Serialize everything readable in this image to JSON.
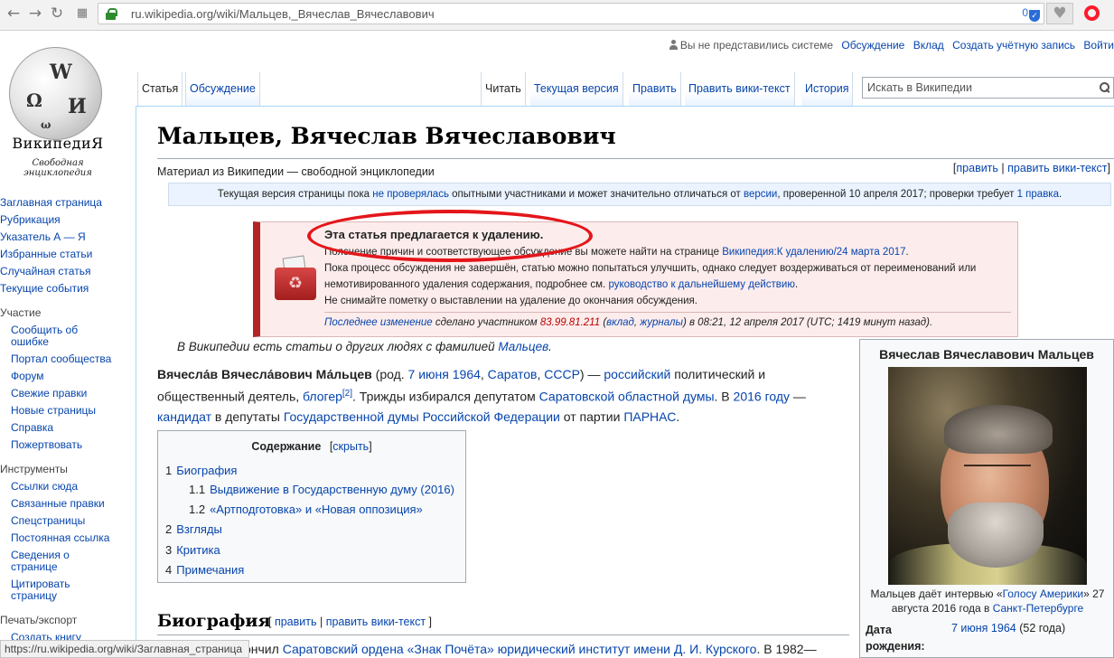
{
  "browser": {
    "url": "ru.wikipedia.org/wiki/Мальцев,_Вячеслав_Вячеславович",
    "ext_count": "0",
    "status_url": "https://ru.wikipedia.org/wiki/Заглавная_страница"
  },
  "logo": {
    "wordmark": "ВикипедиЯ",
    "tagline": "Свободная энциклопедия"
  },
  "personal": {
    "not_logged": "Вы не представились системе",
    "talk": "Обсуждение",
    "contributions": "Вклад",
    "create_account": "Создать учётную запись",
    "login": "Войти"
  },
  "tabs": {
    "article": "Статья",
    "discussion": "Обсуждение",
    "read": "Читать",
    "current": "Текущая версия",
    "edit": "Править",
    "edit_source": "Править вики-текст",
    "history": "История"
  },
  "search": {
    "placeholder": "Искать в Википедии"
  },
  "sidebar": {
    "main": [
      "Заглавная страница",
      "Рубрикация",
      "Указатель А — Я",
      "Избранные статьи",
      "Случайная статья",
      "Текущие события"
    ],
    "participation_heading": "Участие",
    "participation": [
      "Сообщить об ошибке",
      "Портал сообщества",
      "Форум",
      "Свежие правки",
      "Новые страницы",
      "Справка",
      "Пожертвовать"
    ],
    "tools_heading": "Инструменты",
    "tools": [
      "Ссылки сюда",
      "Связанные правки",
      "Спецстраницы",
      "Постоянная ссылка",
      "Сведения о странице",
      "Цитировать страницу"
    ],
    "print_heading": "Печать/экспорт",
    "print": [
      "Создать книгу"
    ]
  },
  "page": {
    "title": "Мальцев, Вячеслав Вячеславович",
    "site_sub": "Материал из Википедии — свободной энциклопедии",
    "edit_links": [
      "[",
      "править",
      " | ",
      "править вики-текст",
      "]"
    ],
    "pending": {
      "t1": "Текущая версия страницы пока ",
      "l1": "не проверялась",
      "t2": " опытными участниками и может значительно отличаться от ",
      "l2": "версии",
      "t3": ", проверенной 10 апреля 2017; проверки требует ",
      "l3": "1 правка",
      "t4": "."
    },
    "deletion": {
      "heading": "Эта статья предлагается к удалению.",
      "p1": "Пояснение причин и соответствующее обсуждение вы можете найти на странице ",
      "p1_link": "Википедия:К удалению/24 марта 2017",
      "p1_end": ".",
      "p2": "Пока процесс обсуждения не завершён, статью можно попытаться улучшить, однако следует воздерживаться от переименований или немотивированного удаления содержания, подробнее см. ",
      "p2_link": "руководство к дальнейшему действию",
      "p2_end": ".",
      "p3": "Не снимайте пометку о выставлении на удаление до окончания обсуждения.",
      "last_change_link": "Последнее изменение",
      "last_change_t1": " сделано участником ",
      "last_change_ip": "83.99.81.211",
      "last_change_t2": " (",
      "last_change_contrib": "вклад",
      "last_change_t3": ", ",
      "last_change_logs": "журналы",
      "last_change_t4": ") в 08:21, 12 апреля 2017 (UTC; 1419 минут назад)."
    },
    "hatnote": {
      "text": "В Википедии есть статьи о других людях с фамилией ",
      "link": "Мальцев",
      "end": "."
    },
    "lead": {
      "name": "Вячесла́в Вячесла́вович Ма́льцев",
      "t1": " (род. ",
      "birth_link": "7 июня 1964",
      "t2": ", ",
      "city_link": "Саратов",
      "t3": ", ",
      "country_link": "СССР",
      "t4": ") — ",
      "nat_link": "российский",
      "t5": " политический и общественный деятель, ",
      "blogger_link": "блогер",
      "ref": "[2]",
      "t6": ". Трижды избирался депутатом ",
      "duma_link": "Саратовской областной думы",
      "t7": ". В ",
      "year_link": "2016 году",
      "t8": " — ",
      "candidate_link": "кандидат",
      "t9": " в депутаты ",
      "gd_link": "Государственной думы Российской Федерации",
      "t10": " от партии ",
      "parnas_link": "ПАРНАС",
      "t11": "."
    },
    "toc": {
      "title": "Содержание",
      "toggle_open": "[",
      "toggle": "скрыть",
      "toggle_close": "]",
      "entries": [
        {
          "num": "1",
          "text": "Биография"
        },
        {
          "num": "1.1",
          "text": "Выдвижение в Государственную думу (2016)"
        },
        {
          "num": "1.2",
          "text": "«Артподготовка» и «Новая оппозиция»"
        },
        {
          "num": "2",
          "text": "Взгляды"
        },
        {
          "num": "3",
          "text": "Критика"
        },
        {
          "num": "4",
          "text": "Примечания"
        }
      ]
    },
    "section": {
      "heading": "Биография",
      "edit_links": [
        "[ ",
        "править",
        " | ",
        "править вики-текст",
        " ]"
      ],
      "text_start": "ончил ",
      "text_link": "Саратовский ордена «Знак Почёта» юридический институт имени Д. И. Курского",
      "text_end": ". В 1982—"
    },
    "infobox": {
      "name": "Вячеслав Вячеславович Мальцев",
      "caption_t1": "Мальцев даёт интервью «",
      "caption_link1": "Голосу Америки",
      "caption_t2": "» 27 августа 2016 года в ",
      "caption_link2": "Санкт-Петербурге",
      "birth_label": "Дата рождения:",
      "birth_link": "7 июня 1964",
      "birth_age": " (52 года)"
    }
  },
  "colors": {
    "link": "#0645ad",
    "deletion_border": "#b32424",
    "deletion_bg": "#fdecec",
    "annotation_ellipse": "#e4161a"
  }
}
